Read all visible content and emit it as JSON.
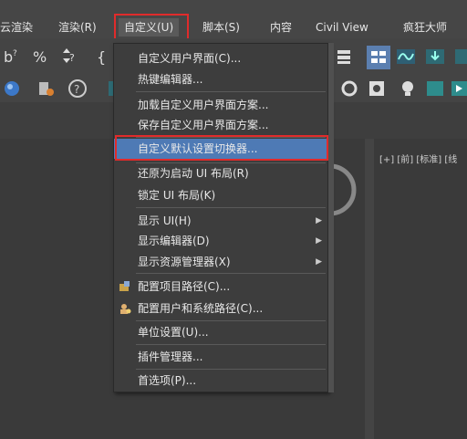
{
  "menubar": {
    "items": [
      {
        "label": "云渲染"
      },
      {
        "label": "渲染(R)"
      },
      {
        "label": "自定义(U)"
      },
      {
        "label": "脚本(S)"
      },
      {
        "label": "内容"
      },
      {
        "label": "Civil View"
      },
      {
        "label": "疯狂大师"
      }
    ]
  },
  "viewports": {
    "right_label": "[+] [前] [标准] [线"
  },
  "menu": {
    "items": [
      {
        "label": "自定义用户界面(C)..."
      },
      {
        "label": "热键编辑器..."
      },
      {
        "label": "加载自定义用户界面方案..."
      },
      {
        "label": "保存自定义用户界面方案..."
      },
      {
        "label": "自定义默认设置切换器..."
      },
      {
        "label": "还原为启动 UI 布局(R)"
      },
      {
        "label": "锁定 UI 布局(K)"
      },
      {
        "label": "显示 UI(H)"
      },
      {
        "label": "显示编辑器(D)"
      },
      {
        "label": "显示资源管理器(X)"
      },
      {
        "label": "配置项目路径(C)..."
      },
      {
        "label": "配置用户和系统路径(C)..."
      },
      {
        "label": "单位设置(U)..."
      },
      {
        "label": "插件管理器..."
      },
      {
        "label": "首选项(P)..."
      }
    ]
  },
  "colors": {
    "highlight": "#4e7ab5",
    "annotation_red": "#e02b2b",
    "background": "#444444"
  }
}
